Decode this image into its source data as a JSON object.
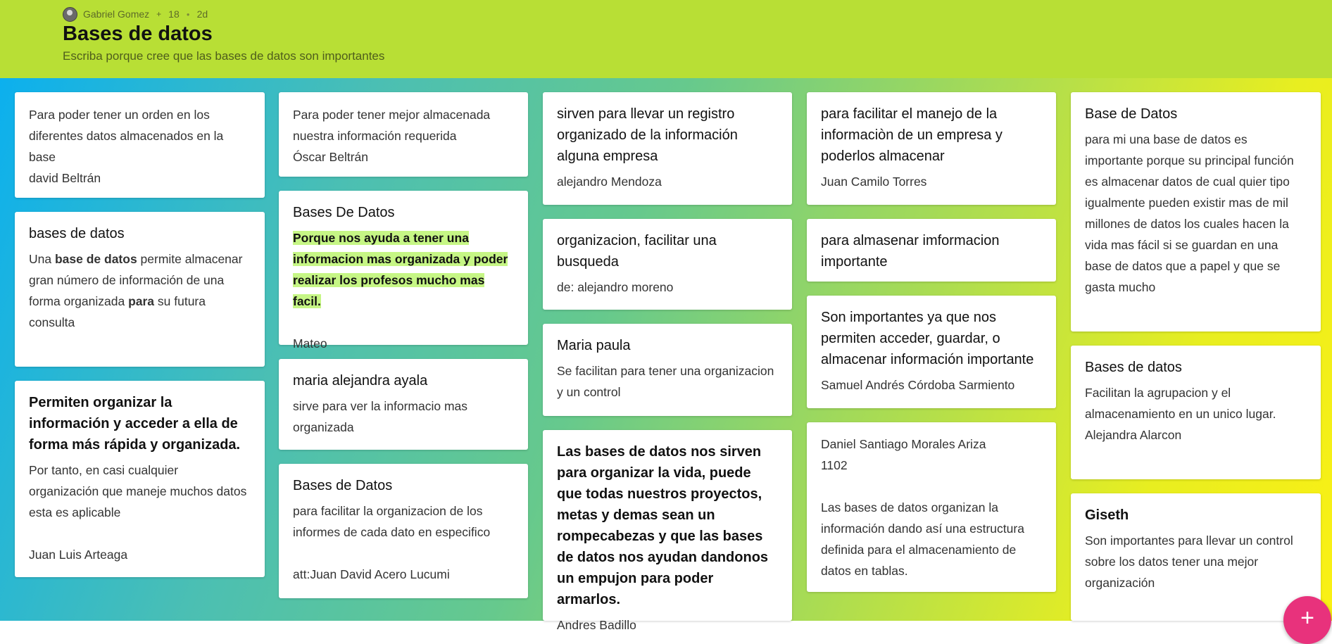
{
  "header": {
    "author": "Gabriel Gomez",
    "plus_icon": "+",
    "count": "18",
    "age": "2d",
    "title": "Bases de datos",
    "subtitle": "Escriba porque cree que las bases de datos son importantes"
  },
  "posts": {
    "p1": {
      "body": "Para poder tener un orden en los diferentes datos almacenados en la base\ndavid Beltrán"
    },
    "p2": {
      "title": "bases de datos",
      "body_a": "Una ",
      "body_b": "base de datos",
      "body_c": " permite almacenar gran número de información de una forma organizada ",
      "body_d": "para",
      "body_e": " su futura consulta"
    },
    "p3": {
      "title": "Permiten organizar la información y acceder a ella de forma más rápida y organizada.",
      "body": "Por tanto, en casi cualquier organización que maneje muchos datos esta es aplicable\n\nJuan Luis Arteaga"
    },
    "p4": {
      "body": "Para poder tener mejor almacenada nuestra información requerida\nÓscar Beltrán"
    },
    "p5": {
      "title": "Bases De Datos",
      "highlight": "Porque nos ayuda a tener una informacion mas organizada y poder realizar los profesos mucho mas facil.",
      "author": "Mateo"
    },
    "p6": {
      "title": "maria alejandra ayala",
      "body": "sirve para ver la informacio mas organizada"
    },
    "p7": {
      "title": "Bases de Datos",
      "body": "para facilitar la organizacion de los informes de cada dato en especifico\n\natt:Juan David Acero Lucumi"
    },
    "p8": {
      "title": "sirven para llevar un registro organizado de la información alguna empresa",
      "body": "alejandro Mendoza"
    },
    "p9": {
      "title": "organizacion, facilitar una busqueda",
      "body": "de: alejandro moreno"
    },
    "p10": {
      "title": "Maria paula",
      "body": "Se facilitan para tener una organizacion y  un control"
    },
    "p11": {
      "title": "Las bases de datos nos sirven para organizar la vida, puede que todas nuestros proyectos, metas y demas sean un rompecabezas y que las bases de datos nos ayudan dandonos un empujon para poder armarlos.",
      "body": "Andres Badillo"
    },
    "p12": {
      "title": "para facilitar el manejo de la informaciòn de un empresa y poderlos almacenar",
      "body": "Juan Camilo Torres"
    },
    "p13": {
      "title": "para almasenar imformacion importante"
    },
    "p14": {
      "title": "Son importantes ya que nos permiten acceder, guardar, o almacenar información importante",
      "body": "Samuel Andrés Córdoba Sarmiento"
    },
    "p15": {
      "body": "Daniel Santiago Morales Ariza\n1102\n\nLas bases de datos organizan la información dando así una estructura definida para el almacenamiento de datos en tablas."
    },
    "p16": {
      "title": "Base de Datos",
      "body": "para mi una base de datos es importante porque su principal función es almacenar datos de cual quier tipo igualmente pueden existir mas de mil millones de datos los cuales hacen la vida mas fácil si se guardan en una base de datos que a papel y que se gasta mucho"
    },
    "p17": {
      "title": "Bases de datos",
      "body": "Facilitan la agrupacion y el almacenamiento en un unico lugar.\nAlejandra Alarcon"
    },
    "p18": {
      "title": "Giseth",
      "body": "Son importantes para llevar un control sobre los datos tener una mejor organización"
    }
  },
  "fab": {
    "label": "+"
  },
  "colors": {
    "header_bg": "#b8df35",
    "fab": "#e8327c",
    "highlight": "#c6f685"
  }
}
